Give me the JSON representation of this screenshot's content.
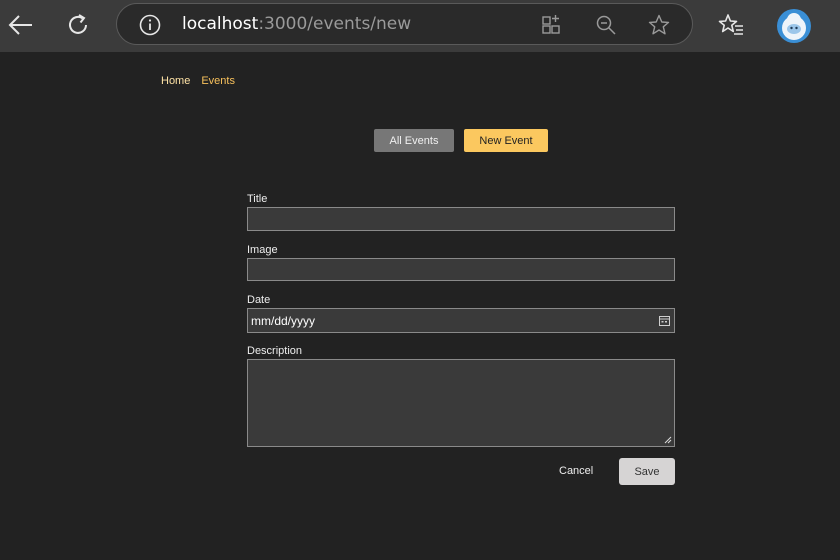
{
  "browser": {
    "url_host": "localhost",
    "url_path": ":3000/events/new"
  },
  "breadcrumb": {
    "home": "Home",
    "events": "Events"
  },
  "tabs": {
    "all_events": "All Events",
    "new_event": "New Event"
  },
  "form": {
    "title_label": "Title",
    "title_value": "",
    "image_label": "Image",
    "image_value": "",
    "date_label": "Date",
    "date_placeholder": "mm/dd/yyyy",
    "description_label": "Description",
    "description_value": ""
  },
  "actions": {
    "cancel": "Cancel",
    "save": "Save"
  },
  "colors": {
    "accent": "#fbc85f",
    "background": "#222222",
    "chrome": "#3b3b3b"
  }
}
